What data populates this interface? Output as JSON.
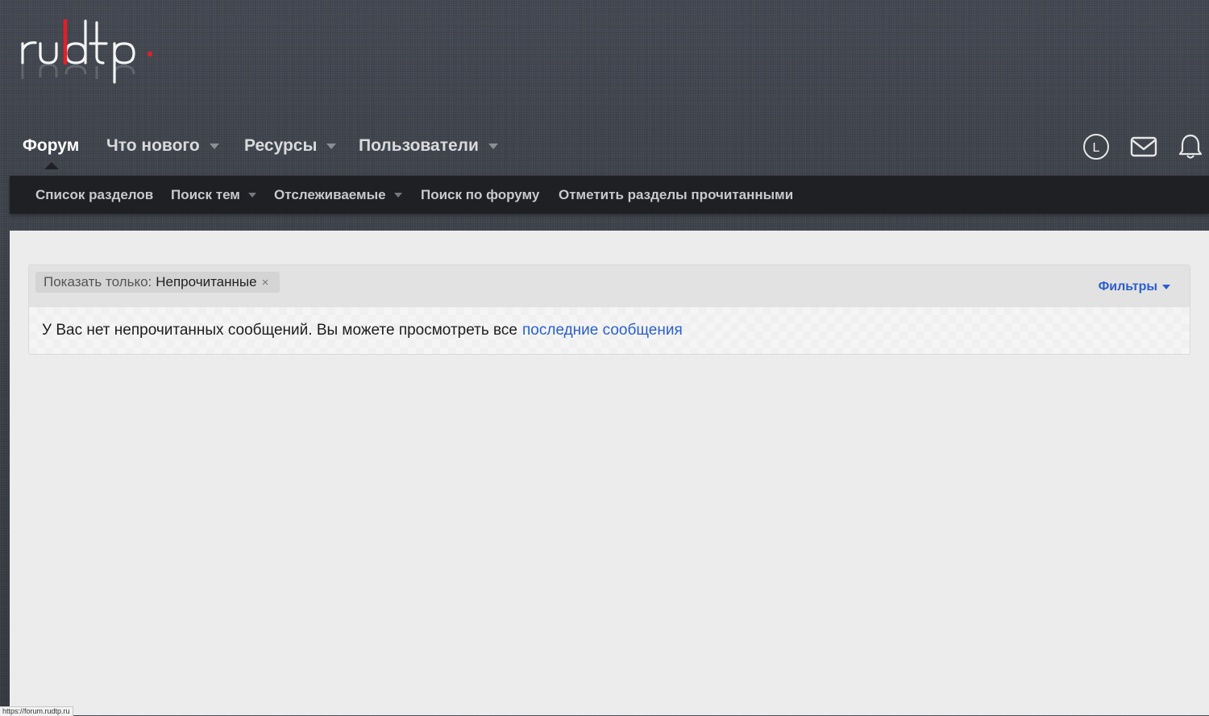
{
  "header": {
    "logo_text": "ru|dtp."
  },
  "nav": {
    "items": [
      {
        "label": "Форум",
        "active": true,
        "has_menu": false
      },
      {
        "label": "Что нового",
        "active": false,
        "has_menu": true
      },
      {
        "label": "Ресурсы",
        "active": false,
        "has_menu": true
      },
      {
        "label": "Пользователи",
        "active": false,
        "has_menu": true
      }
    ],
    "account_avatar_letter": "L",
    "account_icons": [
      "avatar-icon",
      "mail-icon",
      "bell-icon"
    ]
  },
  "subnav": {
    "items": [
      {
        "label": "Список разделов",
        "has_menu": false
      },
      {
        "label": "Поиск тем",
        "has_menu": true
      },
      {
        "label": "Отслеживаемые",
        "has_menu": true
      },
      {
        "label": "Поиск по форуму",
        "has_menu": false
      },
      {
        "label": "Отметить разделы прочитанными",
        "has_menu": false
      }
    ]
  },
  "filter": {
    "chip_label": "Показать только:",
    "chip_value": "Непрочитанные",
    "chip_remove": "×",
    "filters_button": "Фильтры"
  },
  "message": {
    "text": "У Вас нет непрочитанных сообщений. Вы можете просмотреть все",
    "link_text": "последние сообщения"
  },
  "status_bar": {
    "url": "https://forum.rudtp.ru"
  },
  "colors": {
    "accent_link": "#2b5fd0",
    "logo_red": "#e0202a",
    "subnav_bg": "#1f2024",
    "content_bg": "#ececec"
  }
}
